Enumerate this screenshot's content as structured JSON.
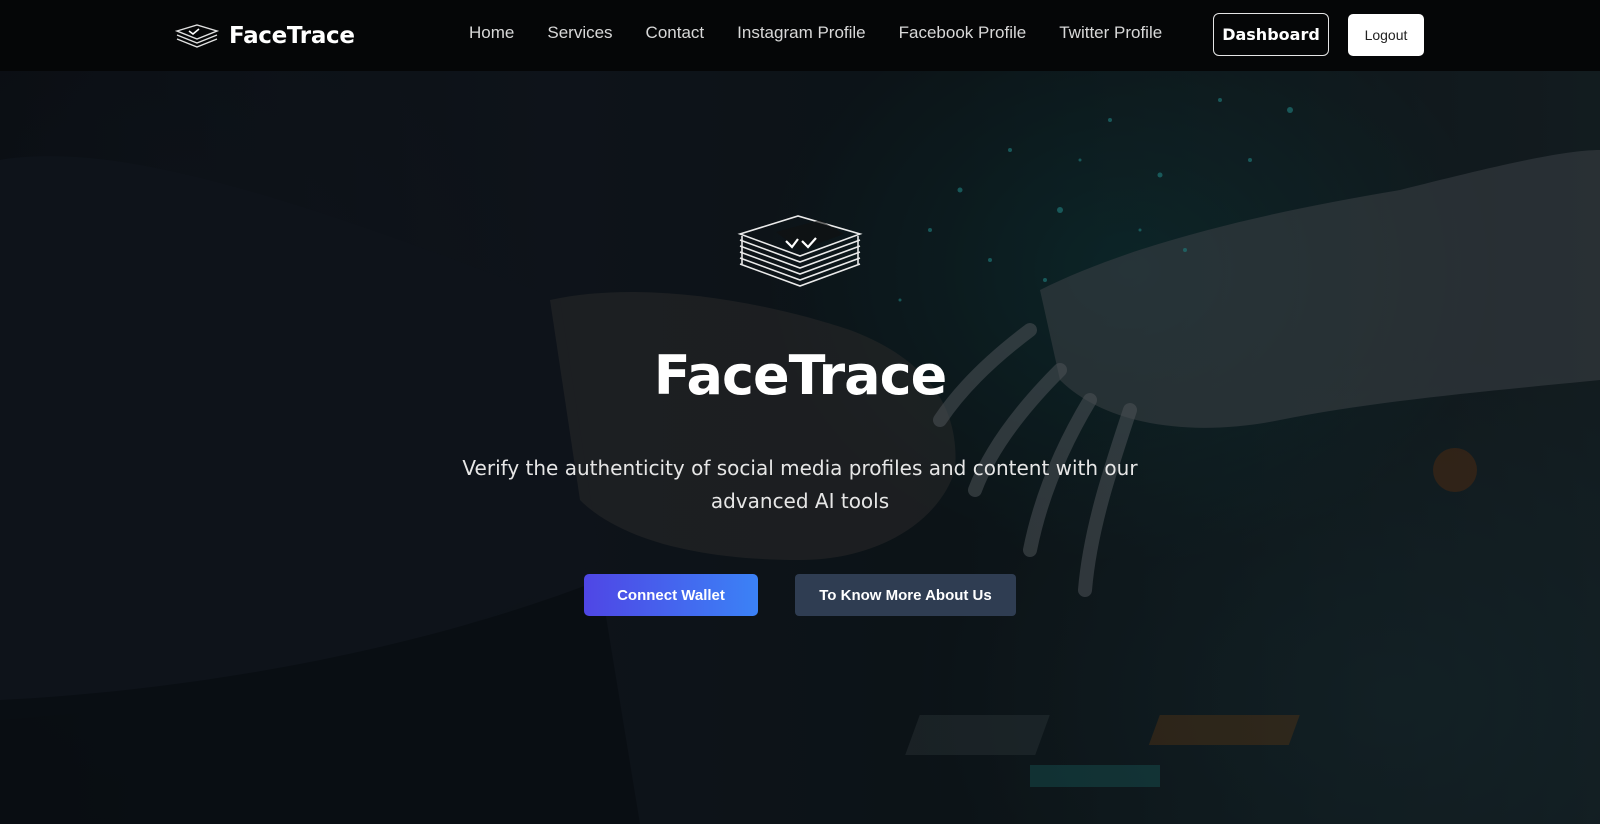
{
  "navbar": {
    "brand": {
      "name": "FaceTrace",
      "icon": "stacked-papers-icon"
    },
    "links": [
      {
        "label": "Home"
      },
      {
        "label": "Services"
      },
      {
        "label": "Contact"
      },
      {
        "label": "Instagram Profile"
      },
      {
        "label": "Facebook Profile"
      },
      {
        "label": "Twitter Profile"
      }
    ],
    "dashboard_label": "Dashboard",
    "logout_label": "Logout"
  },
  "hero": {
    "logo_icon": "stacked-papers-check-icon",
    "title": "FaceTrace",
    "subtitle": "Verify the authenticity of social media profiles and content with our advanced AI tools",
    "primary_button": "Connect Wallet",
    "secondary_button": "To Know More About Us",
    "background_image": "human hand shaking robotic hand"
  },
  "colors": {
    "navbar_bg": "#050607",
    "primary_gradient_start": "#4f46e5",
    "primary_gradient_end": "#3b82f6",
    "secondary_button_bg": "#2f3d52",
    "text": "#ffffff"
  }
}
